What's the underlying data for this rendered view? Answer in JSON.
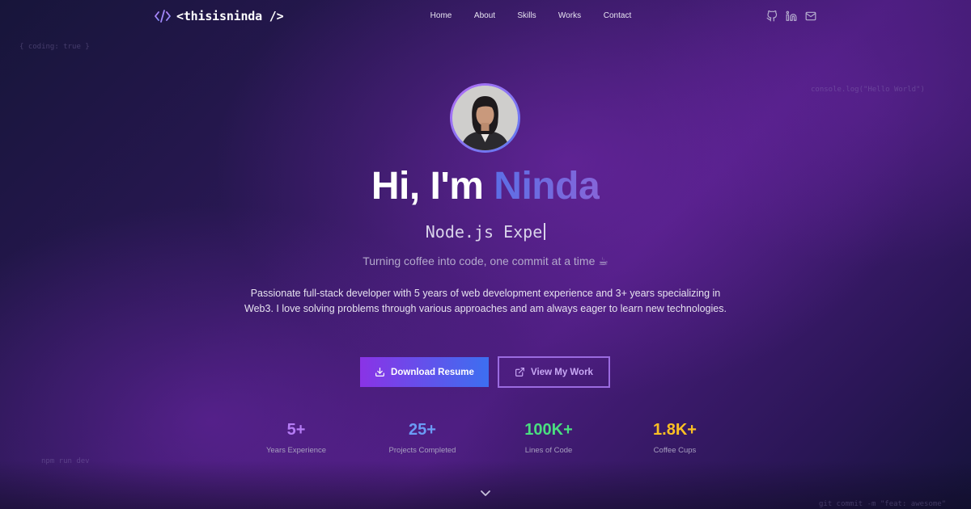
{
  "nav": {
    "logo_text": "<thisisninda />",
    "links": [
      "Home",
      "About",
      "Skills",
      "Works",
      "Contact"
    ],
    "social_icons": [
      "github-icon",
      "linkedin-icon",
      "mail-icon"
    ]
  },
  "decor": {
    "snippet_1": "{ coding: true }",
    "snippet_2": "console.log(\"Hello World\")",
    "snippet_3": "npm run dev",
    "snippet_4": "git commit -m \"feat: awesome\""
  },
  "hero": {
    "greeting": "Hi, I'm ",
    "name": "Ninda",
    "typed_text": "Node.js Expe",
    "tagline": "Turning coffee into code, one commit at a time ☕",
    "bio": "Passionate full-stack developer with 5 years of web development experience and 3+ years specializing in Web3. I love solving problems through various approaches and am always eager to learn new technologies."
  },
  "buttons": {
    "download": "Download Resume",
    "view_work": "View My Work"
  },
  "stats": [
    {
      "value": "5+",
      "label": "Years Experience",
      "color": "#b57cf5"
    },
    {
      "value": "25+",
      "label": "Projects Completed",
      "color": "#6b9bf5"
    },
    {
      "value": "100K+",
      "label": "Lines of Code",
      "color": "#4ade80"
    },
    {
      "value": "1.8K+",
      "label": "Coffee Cups",
      "color": "#fbbf24"
    }
  ],
  "colors": {
    "accent_purple": "#8a33e6",
    "accent_blue": "#3d6ff0",
    "name_gradient_start": "#5c6fe6",
    "name_gradient_end": "#8566d8"
  }
}
